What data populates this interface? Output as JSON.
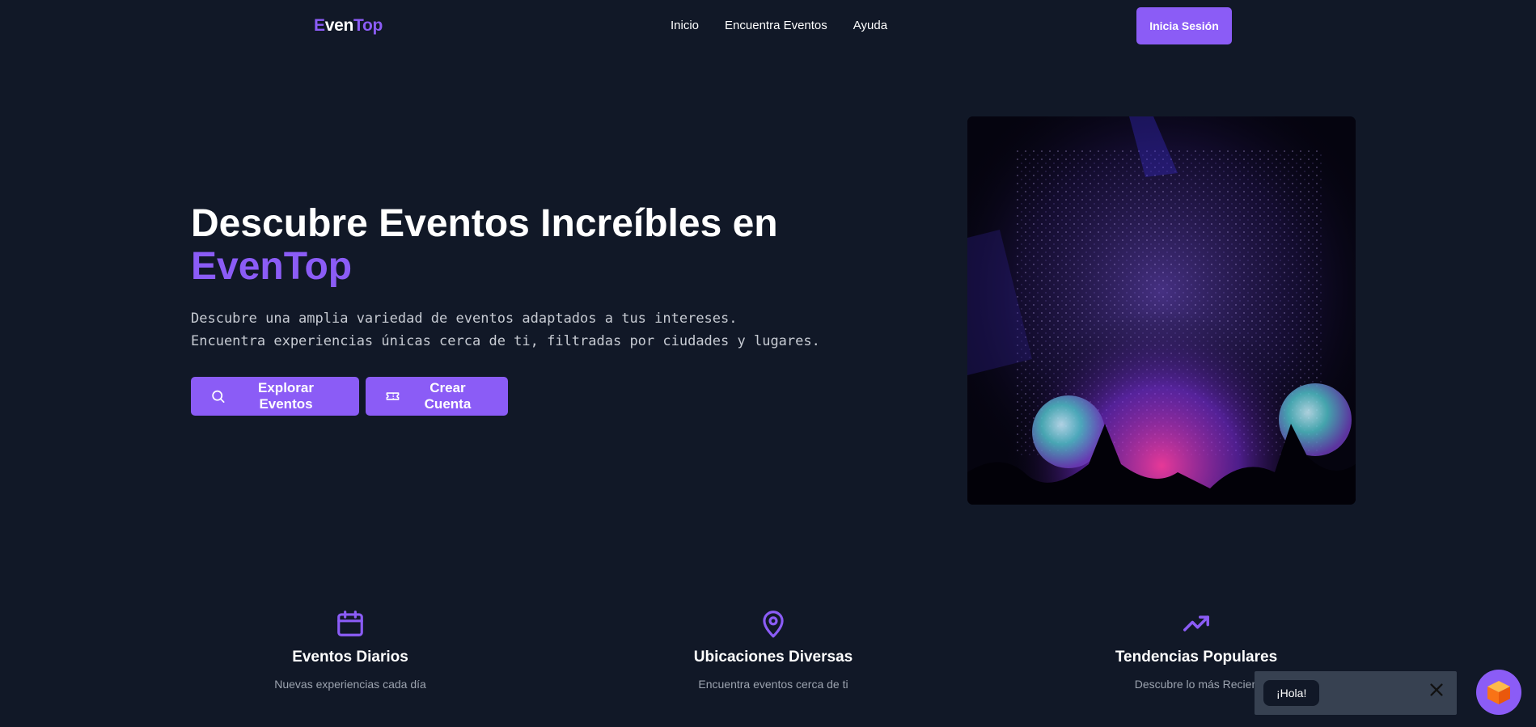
{
  "header": {
    "logo_part1": "E",
    "logo_part2": "ven",
    "logo_part3": "Top",
    "nav": [
      "Inicio",
      "Encuentra Eventos",
      "Ayuda"
    ],
    "login_label": "Inicia Sesión"
  },
  "hero": {
    "title_line1": "Descubre Eventos Increíbles en",
    "title_accent": "EvenTop",
    "desc_line1": "Descubre una amplia variedad de eventos adaptados a tus intereses.",
    "desc_line2": "Encuentra experiencias únicas cerca de ti, filtradas por ciudades y lugares.",
    "btn_explore": "Explorar Eventos",
    "btn_create": "Crear Cuenta",
    "image_icon": "concert-photo"
  },
  "features": [
    {
      "icon": "calendar-icon",
      "title": "Eventos Diarios",
      "desc": "Nuevas experiencias cada día"
    },
    {
      "icon": "map-pin-icon",
      "title": "Ubicaciones Diversas",
      "desc": "Encuentra eventos cerca de ti"
    },
    {
      "icon": "trending-up-icon",
      "title": "Tendencias Populares",
      "desc": "Descubre lo más Recien"
    }
  ],
  "chat": {
    "greeting": "¡Hola!",
    "close_icon": "close-icon",
    "launcher_icon": "cube-icon"
  },
  "colors": {
    "background": "#111827",
    "accent": "#8b5cf6",
    "muted_text": "#9ca3af",
    "chat_panel": "#374151"
  }
}
